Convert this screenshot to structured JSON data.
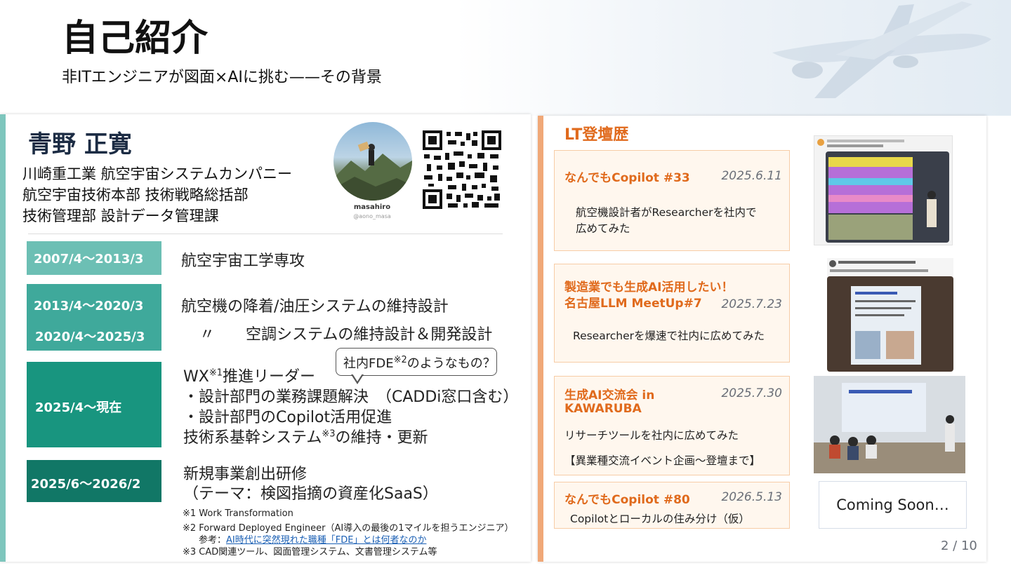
{
  "header": {
    "title": "自己紹介",
    "subtitle": "非ITエンジニアが図面×AIに挑む——その背景"
  },
  "profile": {
    "name": "青野 正寛",
    "affiliation": [
      "川崎重工業 航空宇宙システムカンパニー",
      "航空宇宙技術本部 技術戦略総括部",
      "技術管理部 設計データ管理課"
    ],
    "avatar_name": "masahiro",
    "avatar_handle": "@aono_masa"
  },
  "career": [
    {
      "periods": [
        "2007/4～2013/3"
      ],
      "lines": [
        "航空宇宙工学専攻"
      ],
      "color": "#6cbfb4"
    },
    {
      "periods": [
        "2013/4～2020/3",
        "2020/4～2025/3"
      ],
      "lines": [
        "航空機の降着/油圧システムの維持設計",
        "〃　　空調システムの維持設計＆開発設計"
      ],
      "color": "#3fa99b"
    },
    {
      "periods": [
        "2025/4～現在"
      ],
      "lines": [
        "WX",
        "※1",
        "推進リーダー",
        "・設計部門の業務課題解決　（CADDi窓口含む）",
        "・設計部門のCopilot活用促進",
        "技術系基幹システム",
        "※3",
        "の維持・更新"
      ],
      "color": "#18957f"
    },
    {
      "periods": [
        "2025/6～2026/2"
      ],
      "lines": [
        "新規事業創出研修",
        "（テーマ：検図指摘の資産化SaaS）"
      ],
      "color": "#117766"
    }
  ],
  "callout": {
    "prefix": "社内FDE",
    "sup": "※2",
    "suffix": "のようなもの？"
  },
  "footnotes": {
    "fn1": "※1 Work Transformation",
    "fn2": "※2 Forward Deployed Engineer（AI導入の最後の1マイルを担うエンジニア）",
    "ref_prefix": "参考：",
    "ref_link": "AI時代に突然現れた職種「FDE」とは何者なのか",
    "fn3": "※3 CAD関連ツール、図面管理システム、文書管理システム等"
  },
  "lt": {
    "heading": "LT登壇歴",
    "events": [
      {
        "title": [
          "なんでもCopilot #33"
        ],
        "date": "2025.6.11",
        "desc": [
          "航空機設計者がResearcherを社内で",
          "広めてみた"
        ]
      },
      {
        "title": [
          "製造業でも生成AI活用したい！",
          "名古屋LLM MeetUp#7"
        ],
        "date": "2025.7.23",
        "desc": [
          "Researcherを爆速で社内に広めてみた"
        ]
      },
      {
        "title": [
          "生成AI交流会 in",
          "KAWARUBA"
        ],
        "date": "2025.7.30",
        "desc": [
          "リサーチツールを社内に広めてみた",
          "【異業種交流イベント企画～登壇まで】"
        ]
      },
      {
        "title": [
          "なんでもCopilot #80"
        ],
        "date": "2026.5.13",
        "desc": [
          "Copilotとローカルの住み分け（仮）"
        ]
      }
    ],
    "coming_soon": "Coming Soon…"
  },
  "page": "2 / 10",
  "colors": {
    "accent_orange": "#e06a1c",
    "teal": "#18957f",
    "date_gray": "#6a6f78"
  }
}
